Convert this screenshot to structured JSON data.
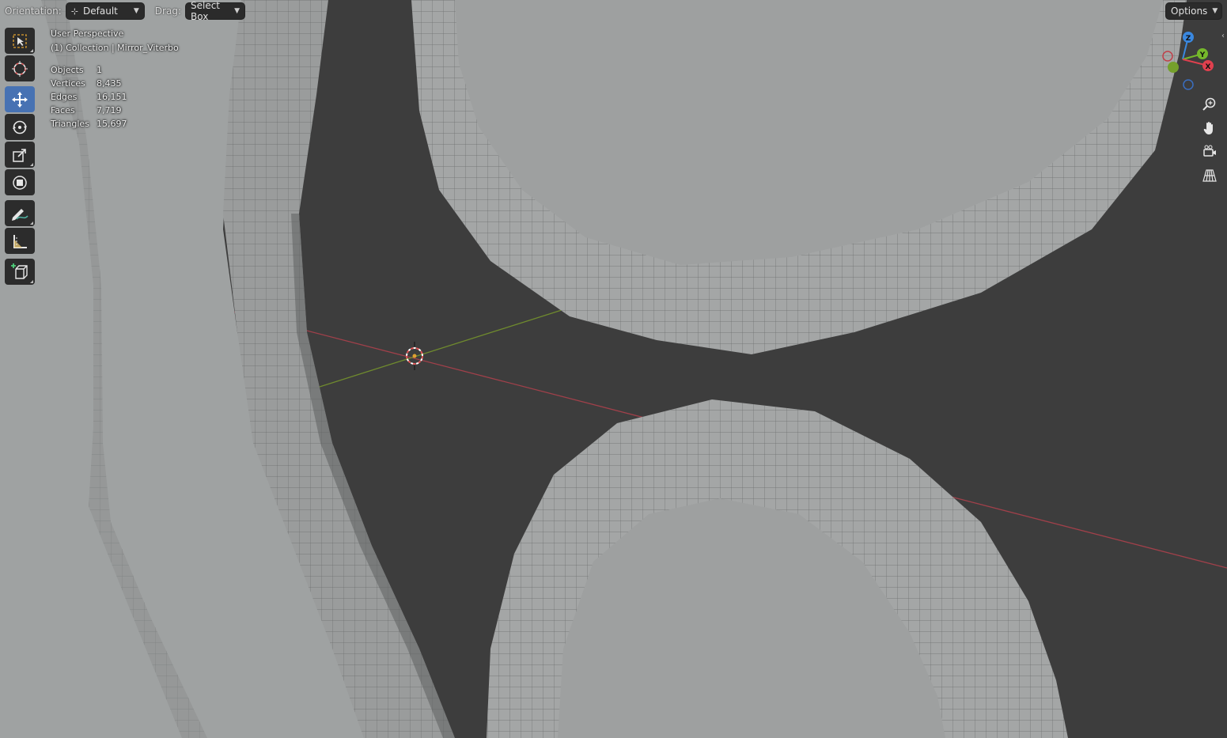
{
  "header": {
    "orientation_label": "Orientation:",
    "orientation_value": "Default",
    "drag_label": "Drag:",
    "drag_value": "Select Box",
    "options_label": "Options"
  },
  "overlay": {
    "view_name": "User Perspective",
    "collection": "(1) Collection | Mirror_Viterbo",
    "stats": [
      {
        "key": "Objects",
        "value": "1"
      },
      {
        "key": "Vertices",
        "value": "8,435"
      },
      {
        "key": "Edges",
        "value": "16,151"
      },
      {
        "key": "Faces",
        "value": "7,719"
      },
      {
        "key": "Triangles",
        "value": "15,697"
      }
    ]
  },
  "toolbar": {
    "tools": [
      {
        "name": "select-box-tool",
        "icon": "select-box-icon",
        "active": false
      },
      {
        "name": "cursor-tool",
        "icon": "cursor-icon",
        "active": false
      },
      {
        "name": "move-tool",
        "icon": "move-icon",
        "active": true
      },
      {
        "name": "rotate-tool",
        "icon": "rotate-icon",
        "active": false
      },
      {
        "name": "scale-tool",
        "icon": "scale-icon",
        "active": false
      },
      {
        "name": "transform-tool",
        "icon": "transform-icon",
        "active": false
      },
      {
        "name": "annotate-tool",
        "icon": "annotate-icon",
        "active": false
      },
      {
        "name": "measure-tool",
        "icon": "measure-icon",
        "active": false
      },
      {
        "name": "add-cube-tool",
        "icon": "add-cube-icon",
        "active": false
      }
    ]
  },
  "gizmo": {
    "axis_labels": {
      "z": "Z",
      "y": "Y",
      "x": "X"
    },
    "colors": {
      "x": "#e0404e",
      "y": "#75b82b",
      "z": "#3a88e0"
    }
  },
  "nav_buttons": [
    "zoom-icon",
    "pan-hand-icon",
    "camera-view-icon",
    "grid-perspective-icon"
  ],
  "colors": {
    "background": "#3d3d3d",
    "mesh": "#9a9c9c",
    "active_tool": "#4772b3",
    "x_axis": "#b5404a",
    "y_axis": "#6f8a2e"
  }
}
